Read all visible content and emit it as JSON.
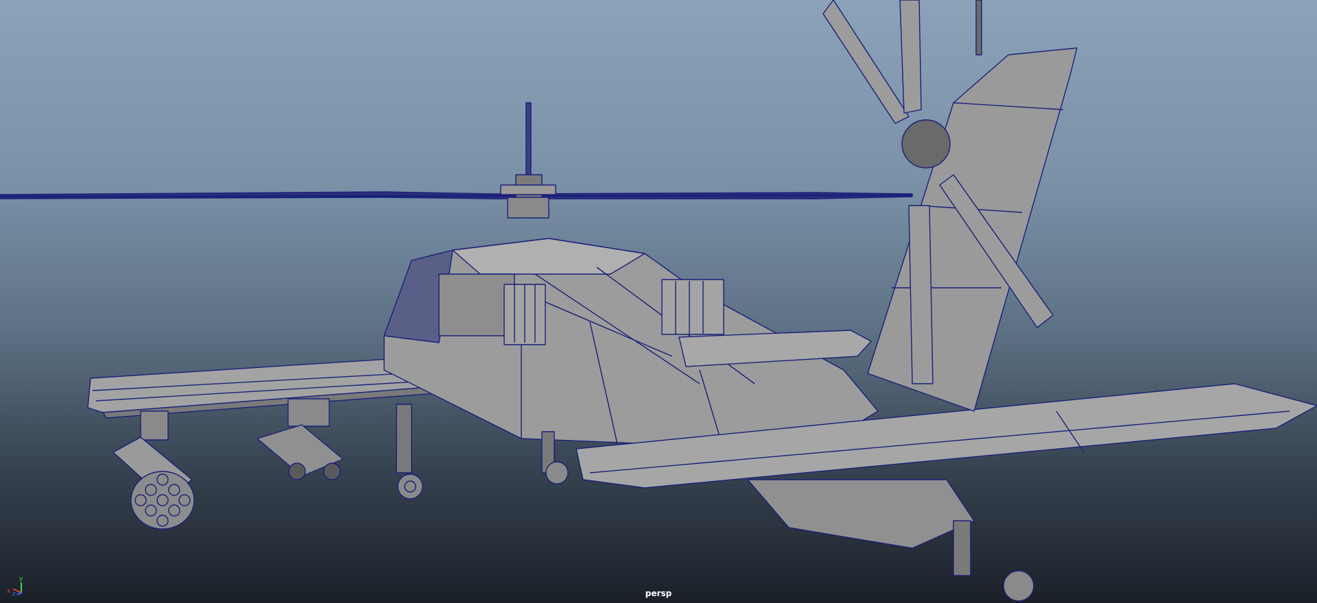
{
  "viewport": {
    "camera_label": "persp",
    "axis_labels": {
      "x": "x",
      "y": "y",
      "z": "z"
    },
    "colors": {
      "background_top": "#8ba2b9",
      "background_bottom": "#1b2028",
      "wireframe": "#1a1f7a",
      "shaded_surface": "#9a9a9a"
    }
  },
  "model": {
    "icon": "helicopter-wireframe-model"
  }
}
